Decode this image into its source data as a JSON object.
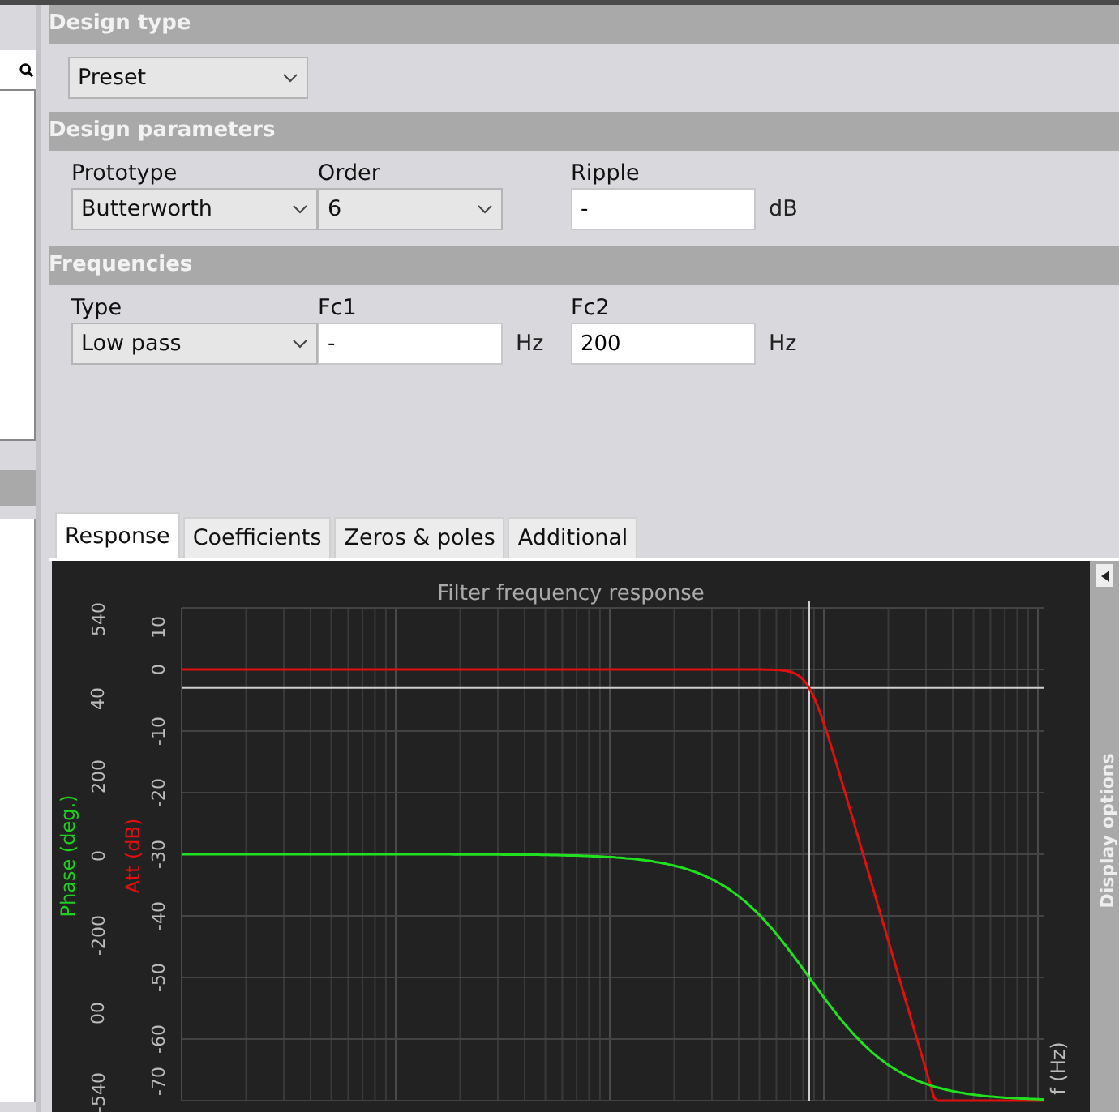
{
  "design_type": {
    "header": "Design type",
    "value": "Preset"
  },
  "design_parameters": {
    "header": "Design parameters",
    "fields": [
      {
        "kind": "select",
        "label": "Prototype",
        "value": "Butterworth"
      },
      {
        "kind": "select",
        "label": "Order",
        "value": "6"
      },
      {
        "kind": "input",
        "label": "Ripple",
        "value": "-",
        "unit": "dB"
      }
    ]
  },
  "frequencies": {
    "header": "Frequencies",
    "fields": [
      {
        "kind": "select",
        "label": "Type",
        "value": "Low pass"
      },
      {
        "kind": "input",
        "label": "Fc1",
        "value": "-",
        "unit": "Hz"
      },
      {
        "kind": "input",
        "label": "Fc2",
        "value": "200",
        "unit": "Hz"
      }
    ]
  },
  "tabs": [
    {
      "label": "Response",
      "selected": true
    },
    {
      "label": "Coefficients",
      "selected": false
    },
    {
      "label": "Zeros & poles",
      "selected": false
    },
    {
      "label": "Additional",
      "selected": false
    }
  ],
  "chart": {
    "title": "Filter frequency response",
    "phase_axis": {
      "title": "Phase (deg.)",
      "ticks": [
        "540",
        "40",
        "200",
        "0",
        "-200",
        "00",
        "-540"
      ]
    },
    "att_axis": {
      "title": "Att (dB)",
      "ticks": [
        "10",
        "0",
        "-10",
        "-20",
        "-30",
        "-40",
        "-50",
        "-60",
        "-70"
      ]
    },
    "x_axis_title": "f (Hz)"
  },
  "side_panel": {
    "title": "Display options"
  }
}
